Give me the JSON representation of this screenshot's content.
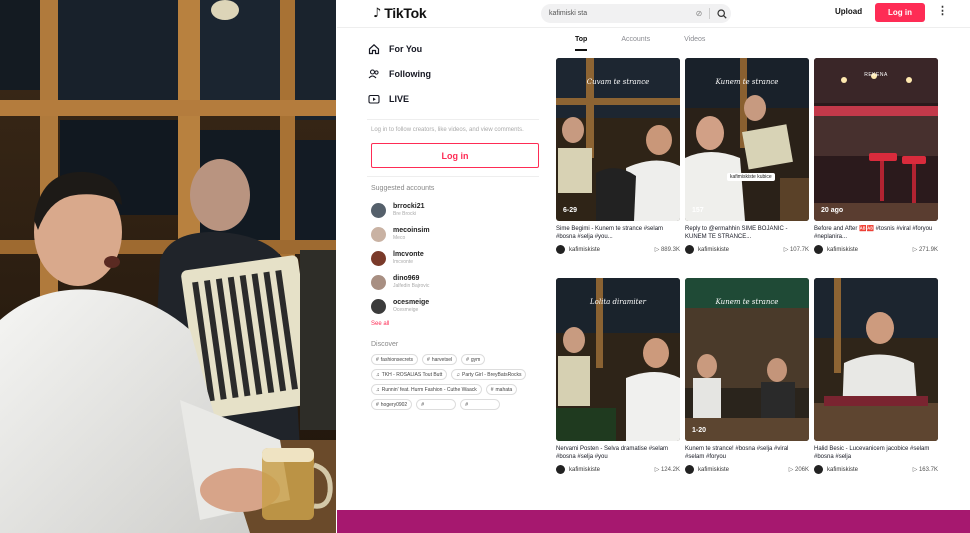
{
  "tiktok": {
    "logo_text": "TikTok",
    "search_query": "kafimiski sta",
    "upload_label": "Upload",
    "login_label": "Log in",
    "more_label": "⋮"
  },
  "sidebar": {
    "nav": [
      {
        "label": "For You",
        "icon": "home-icon"
      },
      {
        "label": "Following",
        "icon": "people-icon"
      },
      {
        "label": "LIVE",
        "icon": "live-icon"
      }
    ],
    "login_prompt": "Log in to follow creators, like videos, and view comments.",
    "login_button": "Log in",
    "suggested_title": "Suggested accounts",
    "accounts": [
      {
        "name": "brrocki21",
        "sub": "Bre Brocki",
        "avatar_color": "#55606b"
      },
      {
        "name": "mecoinsim",
        "sub": "Meco",
        "avatar_color": "#c9b2a3"
      },
      {
        "name": "lmcvonte",
        "sub": "lmcvonte",
        "avatar_color": "#7a3a2a"
      },
      {
        "name": "dino969",
        "sub": "Jalfedin Bajrovic",
        "avatar_color": "#a88f82"
      },
      {
        "name": "ocesmeige",
        "sub": "Ocesmeige",
        "avatar_color": "#3b3b3b"
      }
    ],
    "see_all": "See all",
    "discover_title": "Discover",
    "tags": [
      {
        "prefix": "#",
        "text": "fashionsecrets"
      },
      {
        "prefix": "#",
        "text": "harvetsel"
      },
      {
        "prefix": "#",
        "text": "gym"
      },
      {
        "prefix": "♫",
        "text": "TKH - ROSALIAS Tout Butt"
      },
      {
        "prefix": "♫",
        "text": "Party Girl - BreyBatsRocks"
      },
      {
        "prefix": "♫",
        "text": "Runnin' feat. Hurm Fashion - Cuthe Waack"
      },
      {
        "prefix": "#",
        "text": "mahata"
      },
      {
        "prefix": "#",
        "text": "hogery0902"
      },
      {
        "prefix": "#",
        "text": ""
      },
      {
        "prefix": "#",
        "text": ""
      }
    ]
  },
  "tabs": [
    {
      "label": "Top",
      "active": true
    },
    {
      "label": "Accounts",
      "active": false
    },
    {
      "label": "Videos",
      "active": false
    }
  ],
  "videos": [
    {
      "overlay": "Cuvam te strance",
      "overlay_tag": "",
      "caption": "",
      "time": "6-29",
      "desc": "Sime Begimi - Kunem te strance #selam #bosna #selja #you...",
      "author": "kafimiskiste",
      "plays": "889.3K"
    },
    {
      "overlay": "Kunem te strance",
      "overlay_tag": "",
      "caption": "kafimiskiste kubice",
      "time": "157",
      "desc": "Reply to @ermahhin SIME BOJANIC - KUNEM TE STRANCE...",
      "author": "kafimiskiste",
      "plays": "107.7K"
    },
    {
      "overlay": "",
      "overlay_tag": "REKENA",
      "caption": "",
      "time": "20 ago",
      "desc": "Before and After 🆎🆎 #tosnis #viral #foryou #neplanira...",
      "author": "kafimiskiste",
      "plays": "271.9K"
    },
    {
      "overlay": "Lolita diramiter",
      "overlay_tag": "",
      "caption": "",
      "time": "",
      "desc": "Nervami Posten - Selva dramatise #selam #bosna #selja #you",
      "author": "kafimiskiste",
      "plays": "124.2K"
    },
    {
      "overlay": "Kunem te strance",
      "overlay_tag": "",
      "caption": "",
      "time": "1-20",
      "desc": "Kunem te strance! #bosna #selja #viral #selam #foryou",
      "author": "kafimiskiste",
      "plays": "206K"
    },
    {
      "overlay": "",
      "overlay_tag": "",
      "caption": "",
      "time": "",
      "desc": "Halid Besic - Lucevanicem jacobice #selam #bosna #selja",
      "author": "kafimiskiste",
      "plays": "163.7K"
    }
  ],
  "colors": {
    "brand_red": "#fe2c55",
    "bottom_band": "#a6186f"
  }
}
